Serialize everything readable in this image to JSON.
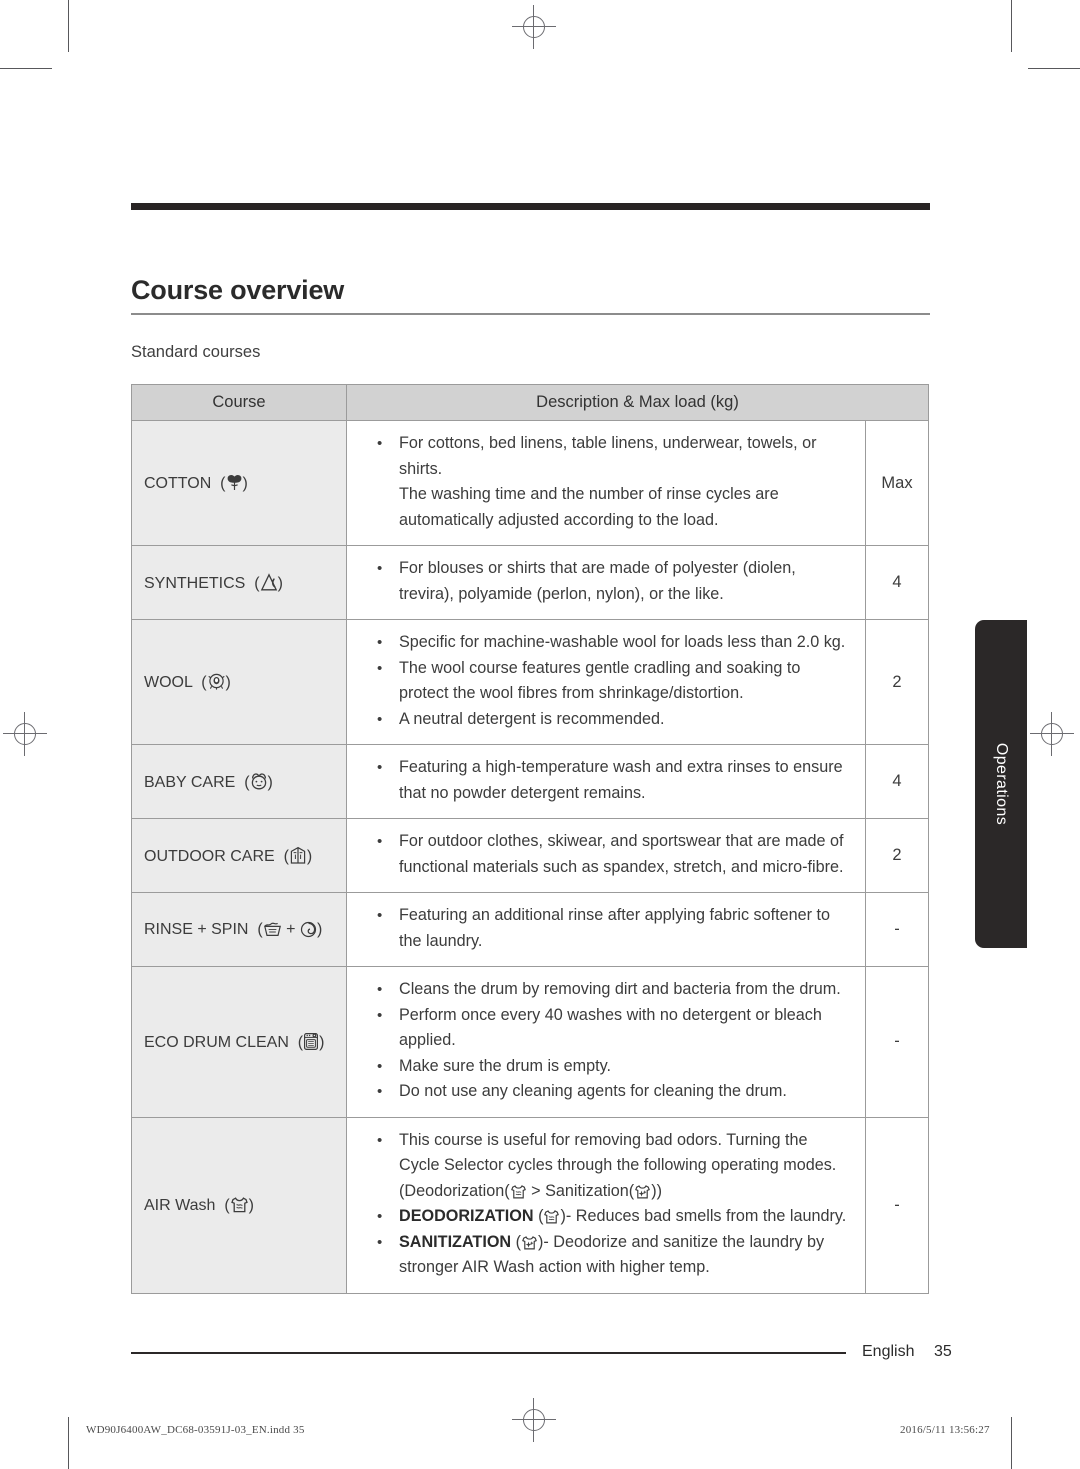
{
  "document": {
    "heading": "Course overview",
    "subheading": "Standard courses",
    "side_tab_label": "Operations",
    "footer": {
      "language": "English",
      "page_number": "35",
      "print_filename": "WD90J6400AW_DC68-03591J-03_EN.indd   35",
      "print_timestamp": "2016/5/11   13:56:27"
    }
  },
  "table": {
    "headers": {
      "course": "Course",
      "description": "Description & Max load (kg)"
    },
    "rows": [
      {
        "course_label": "COTTON",
        "course_icon": "cotton-flower-icon",
        "max_load": "Max",
        "bullets": [
          {
            "bulleted": true,
            "text": "For cottons, bed linens, table linens, underwear, towels, or shirts."
          },
          {
            "bulleted": false,
            "text": "The washing time and the number of rinse cycles are automatically adjusted according to the load."
          }
        ]
      },
      {
        "course_label": "SYNTHETICS",
        "course_icon": "synthetics-icon",
        "max_load": "4",
        "bullets": [
          {
            "bulleted": true,
            "text": "For blouses or shirts that are made of polyester (diolen, trevira), polyamide (perlon, nylon), or the like."
          }
        ]
      },
      {
        "course_label": "WOOL",
        "course_icon": "wool-sheep-icon",
        "max_load": "2",
        "bullets": [
          {
            "bulleted": true,
            "text": "Specific for machine-washable wool for loads less than 2.0 kg."
          },
          {
            "bulleted": true,
            "text": "The wool course features gentle cradling and soaking to protect the wool fibres from shrinkage/distortion."
          },
          {
            "bulleted": true,
            "text": "A neutral detergent is recommended."
          }
        ]
      },
      {
        "course_label": "BABY CARE",
        "course_icon": "baby-care-icon",
        "max_load": "4",
        "bullets": [
          {
            "bulleted": true,
            "text": "Featuring a high-temperature wash and extra rinses to ensure that no powder detergent remains."
          }
        ]
      },
      {
        "course_label": "OUTDOOR CARE",
        "course_icon": "outdoor-jacket-icon",
        "max_load": "2",
        "bullets": [
          {
            "bulleted": true,
            "text": "For outdoor clothes, skiwear, and sportswear that are made of functional materials such as spandex, stretch, and micro-fibre."
          }
        ]
      },
      {
        "course_label": "RINSE + SPIN",
        "course_icon": "rinse-plus-spin-icon",
        "max_load": "-",
        "bullets": [
          {
            "bulleted": true,
            "text": "Featuring an additional rinse after applying fabric softener to the laundry."
          }
        ]
      },
      {
        "course_label": "ECO DRUM CLEAN",
        "course_icon": "eco-drum-clean-icon",
        "max_load": "-",
        "bullets": [
          {
            "bulleted": true,
            "text": "Cleans the drum by removing dirt and bacteria from the drum."
          },
          {
            "bulleted": true,
            "text": "Perform once every 40 washes with no detergent or bleach applied."
          },
          {
            "bulleted": true,
            "text": "Make sure the drum is empty."
          },
          {
            "bulleted": true,
            "text": "Do not use any cleaning agents for cleaning the drum."
          }
        ]
      },
      {
        "course_label": "AIR Wash",
        "course_icon": "air-wash-deodorization-icon",
        "max_load": "-",
        "bullets": []
      }
    ],
    "air_wash": {
      "line1_a": "This course is useful for removing bad odors. Turning the Cycle Selector cycles through the following operating modes.(Deodorization(",
      "line1_b": " > Sanitization(",
      "line1_c": "))",
      "deodorization_label": "DEODORIZATION",
      "deodorization_text": "- Reduces bad smells from the laundry.",
      "sanitization_label": "SANITIZATION",
      "sanitization_text": "- Deodorize and sanitize the laundry by stronger AIR Wash action with higher temp."
    }
  },
  "colors": {
    "header_bar": "#282424",
    "table_head_bg": "#d2d2d2",
    "course_cell_bg": "#ebebeb",
    "side_tab_bg": "#2b2828",
    "text": "#3c3c3c"
  }
}
